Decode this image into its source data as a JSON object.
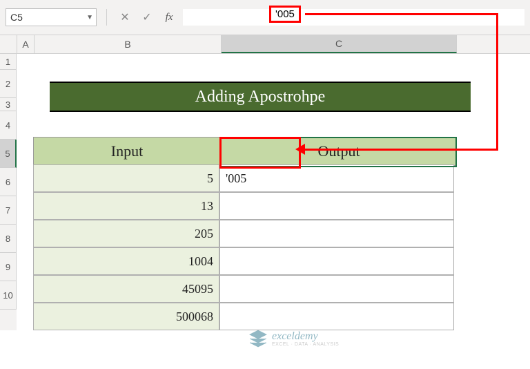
{
  "namebox": {
    "value": "C5"
  },
  "formula_bar": {
    "value": "'005"
  },
  "columns": {
    "A": "A",
    "B": "B",
    "C": "C"
  },
  "rows": [
    "1",
    "2",
    "3",
    "4",
    "5",
    "6",
    "7",
    "8",
    "9",
    "10"
  ],
  "title": "Adding Apostrohpe",
  "headers": {
    "input": "Input",
    "output": "Output"
  },
  "data": {
    "inputs": [
      "5",
      "13",
      "205",
      "1004",
      "45095",
      "500068"
    ],
    "outputs": [
      "'005",
      "",
      "",
      "",
      "",
      ""
    ]
  },
  "icons": {
    "dropdown": "▼",
    "cancel": "✕",
    "check": "✓",
    "fx": "fx"
  },
  "watermark": {
    "main": "exceldemy",
    "sub": "EXCEL · DATA · ANALYSIS"
  },
  "chart_data": {
    "type": "table",
    "title": "Adding Apostrohpe",
    "columns": [
      "Input",
      "Output"
    ],
    "rows": [
      [
        5,
        "'005"
      ],
      [
        13,
        ""
      ],
      [
        205,
        ""
      ],
      [
        1004,
        ""
      ],
      [
        45095,
        ""
      ],
      [
        500068,
        ""
      ]
    ],
    "formula_bar": "'005",
    "selected_cell": "C5"
  }
}
